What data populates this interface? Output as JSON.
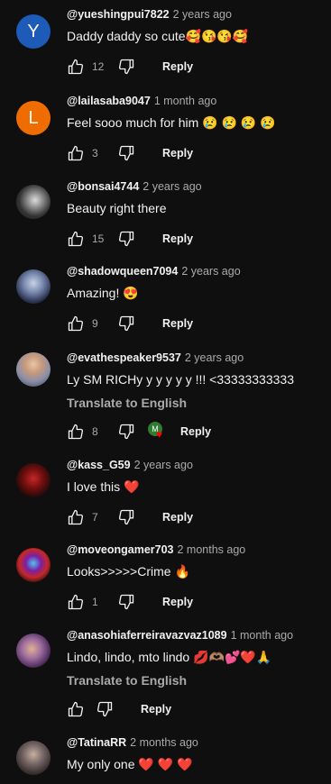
{
  "reply_label": "Reply",
  "translate_label": "Translate to English",
  "colors": {
    "like_icon": "#f1f1f1",
    "meta_gray": "#aaaaaa",
    "heart_red": "#ff0000"
  },
  "comments": [
    {
      "handle": "@yueshingpui7822",
      "time": "2 years ago",
      "text": "Daddy daddy so cute🥰😘😘🥰",
      "likes": "12",
      "avatar_letter": "Y",
      "avatar_color": "#1e5ab8"
    },
    {
      "handle": "@lailasaba9047",
      "time": "1 month ago",
      "text": "Feel sooo much for him 😢 😢 😢 😢",
      "likes": "3",
      "avatar_letter": "L",
      "avatar_color": "#ef6c00"
    },
    {
      "handle": "@bonsai4744",
      "time": "2 years ago",
      "text": "Beauty right there",
      "likes": "15"
    },
    {
      "handle": "@shadowqueen7094",
      "time": "2 years ago",
      "text": "Amazing! 😍",
      "likes": "9"
    },
    {
      "handle": "@evathespeaker9537",
      "time": "2 years ago",
      "text": "Ly SM RICHy y y y y y  !!! <33333333333",
      "likes": "8",
      "creator_heart_initial": "M"
    },
    {
      "handle": "@kass_G59",
      "time": "2 years ago",
      "text": "I love this ❤️",
      "likes": "7"
    },
    {
      "handle": "@moveongamer703",
      "time": "2 months ago",
      "text": "Looks>>>>>Crime 🔥",
      "likes": "1"
    },
    {
      "handle": "@anasohiaferreiravazvaz1089",
      "time": "1 month ago",
      "text": "Lindo, lindo, mto lindo 💋🫶🏽💕❤️🙏",
      "likes": ""
    },
    {
      "handle": "@TatinaRR",
      "time": "2 months ago",
      "text": "My only one ❤️ ❤️ ❤️",
      "likes": ""
    }
  ]
}
